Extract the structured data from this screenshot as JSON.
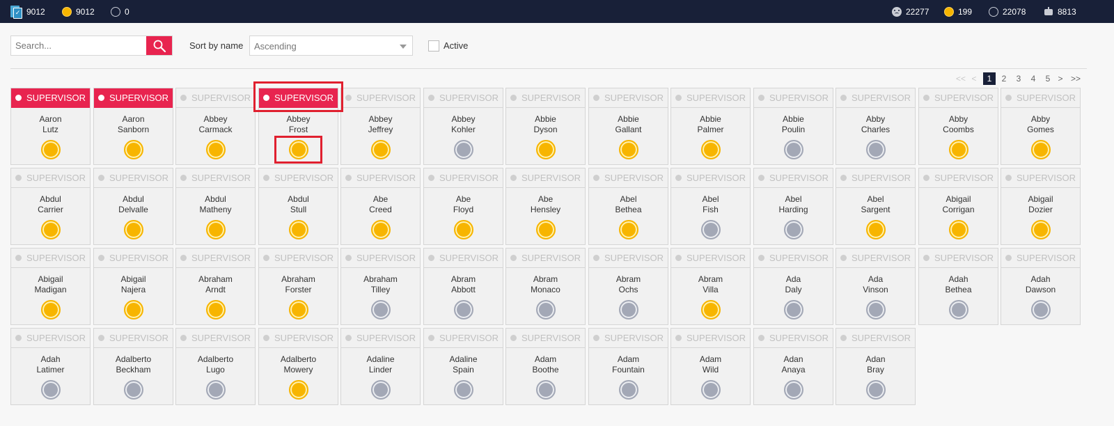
{
  "topbar": {
    "left_stats": [
      "9012",
      "9012",
      "0"
    ],
    "right_stats": [
      "22277",
      "199",
      "22078",
      "8813"
    ]
  },
  "search": {
    "placeholder": "Search..."
  },
  "sort": {
    "label": "Sort by name",
    "value": "Ascending"
  },
  "filter": {
    "active_label": "Active"
  },
  "pagination": {
    "first": "<<",
    "prev": "<",
    "pages": [
      "1",
      "2",
      "3",
      "4",
      "5"
    ],
    "current": "1",
    "next": ">",
    "last": ">>"
  },
  "colors": {
    "accent_red": "#e8244f",
    "navy": "#182038",
    "status_active": "#f7b500",
    "status_inactive": "#a3a8b6"
  },
  "role_label": "SUPERVISOR",
  "people": [
    {
      "first": "Aaron",
      "last": "Lutz",
      "status": "active",
      "selected": true
    },
    {
      "first": "Aaron",
      "last": "Sanborn",
      "status": "active",
      "selected": true
    },
    {
      "first": "Abbey",
      "last": "Carmack",
      "status": "active",
      "selected": false
    },
    {
      "first": "Abbey",
      "last": "Frost",
      "status": "active",
      "selected": true
    },
    {
      "first": "Abbey",
      "last": "Jeffrey",
      "status": "active",
      "selected": false
    },
    {
      "first": "Abbey",
      "last": "Kohler",
      "status": "inactive",
      "selected": false
    },
    {
      "first": "Abbie",
      "last": "Dyson",
      "status": "active",
      "selected": false
    },
    {
      "first": "Abbie",
      "last": "Gallant",
      "status": "active",
      "selected": false
    },
    {
      "first": "Abbie",
      "last": "Palmer",
      "status": "active",
      "selected": false
    },
    {
      "first": "Abbie",
      "last": "Poulin",
      "status": "inactive",
      "selected": false
    },
    {
      "first": "Abby",
      "last": "Charles",
      "status": "inactive",
      "selected": false
    },
    {
      "first": "Abby",
      "last": "Coombs",
      "status": "active",
      "selected": false
    },
    {
      "first": "Abby",
      "last": "Gomes",
      "status": "active",
      "selected": false
    },
    {
      "first": "Abdul",
      "last": "Carrier",
      "status": "active",
      "selected": false
    },
    {
      "first": "Abdul",
      "last": "Delvalle",
      "status": "active",
      "selected": false
    },
    {
      "first": "Abdul",
      "last": "Matheny",
      "status": "active",
      "selected": false
    },
    {
      "first": "Abdul",
      "last": "Stull",
      "status": "active",
      "selected": false
    },
    {
      "first": "Abe",
      "last": "Creed",
      "status": "active",
      "selected": false
    },
    {
      "first": "Abe",
      "last": "Floyd",
      "status": "active",
      "selected": false
    },
    {
      "first": "Abe",
      "last": "Hensley",
      "status": "active",
      "selected": false
    },
    {
      "first": "Abel",
      "last": "Bethea",
      "status": "active",
      "selected": false
    },
    {
      "first": "Abel",
      "last": "Fish",
      "status": "inactive",
      "selected": false
    },
    {
      "first": "Abel",
      "last": "Harding",
      "status": "inactive",
      "selected": false
    },
    {
      "first": "Abel",
      "last": "Sargent",
      "status": "active",
      "selected": false
    },
    {
      "first": "Abigail",
      "last": "Corrigan",
      "status": "active",
      "selected": false
    },
    {
      "first": "Abigail",
      "last": "Dozier",
      "status": "active",
      "selected": false
    },
    {
      "first": "Abigail",
      "last": "Madigan",
      "status": "active",
      "selected": false
    },
    {
      "first": "Abigail",
      "last": "Najera",
      "status": "active",
      "selected": false
    },
    {
      "first": "Abraham",
      "last": "Arndt",
      "status": "active",
      "selected": false
    },
    {
      "first": "Abraham",
      "last": "Forster",
      "status": "active",
      "selected": false
    },
    {
      "first": "Abraham",
      "last": "Tilley",
      "status": "inactive",
      "selected": false
    },
    {
      "first": "Abram",
      "last": "Abbott",
      "status": "inactive",
      "selected": false
    },
    {
      "first": "Abram",
      "last": "Monaco",
      "status": "inactive",
      "selected": false
    },
    {
      "first": "Abram",
      "last": "Ochs",
      "status": "inactive",
      "selected": false
    },
    {
      "first": "Abram",
      "last": "Villa",
      "status": "active",
      "selected": false
    },
    {
      "first": "Ada",
      "last": "Daly",
      "status": "inactive",
      "selected": false
    },
    {
      "first": "Ada",
      "last": "Vinson",
      "status": "inactive",
      "selected": false
    },
    {
      "first": "Adah",
      "last": "Bethea",
      "status": "inactive",
      "selected": false
    },
    {
      "first": "Adah",
      "last": "Dawson",
      "status": "inactive",
      "selected": false
    },
    {
      "first": "Adah",
      "last": "Latimer",
      "status": "inactive",
      "selected": false
    },
    {
      "first": "Adalberto",
      "last": "Beckham",
      "status": "inactive",
      "selected": false
    },
    {
      "first": "Adalberto",
      "last": "Lugo",
      "status": "inactive",
      "selected": false
    },
    {
      "first": "Adalberto",
      "last": "Mowery",
      "status": "active",
      "selected": false
    },
    {
      "first": "Adaline",
      "last": "Linder",
      "status": "inactive",
      "selected": false
    },
    {
      "first": "Adaline",
      "last": "Spain",
      "status": "inactive",
      "selected": false
    },
    {
      "first": "Adam",
      "last": "Boothe",
      "status": "inactive",
      "selected": false
    },
    {
      "first": "Adam",
      "last": "Fountain",
      "status": "inactive",
      "selected": false
    },
    {
      "first": "Adam",
      "last": "Wild",
      "status": "inactive",
      "selected": false
    },
    {
      "first": "Adan",
      "last": "Anaya",
      "status": "inactive",
      "selected": false
    },
    {
      "first": "Adan",
      "last": "Bray",
      "status": "inactive",
      "selected": false
    }
  ]
}
